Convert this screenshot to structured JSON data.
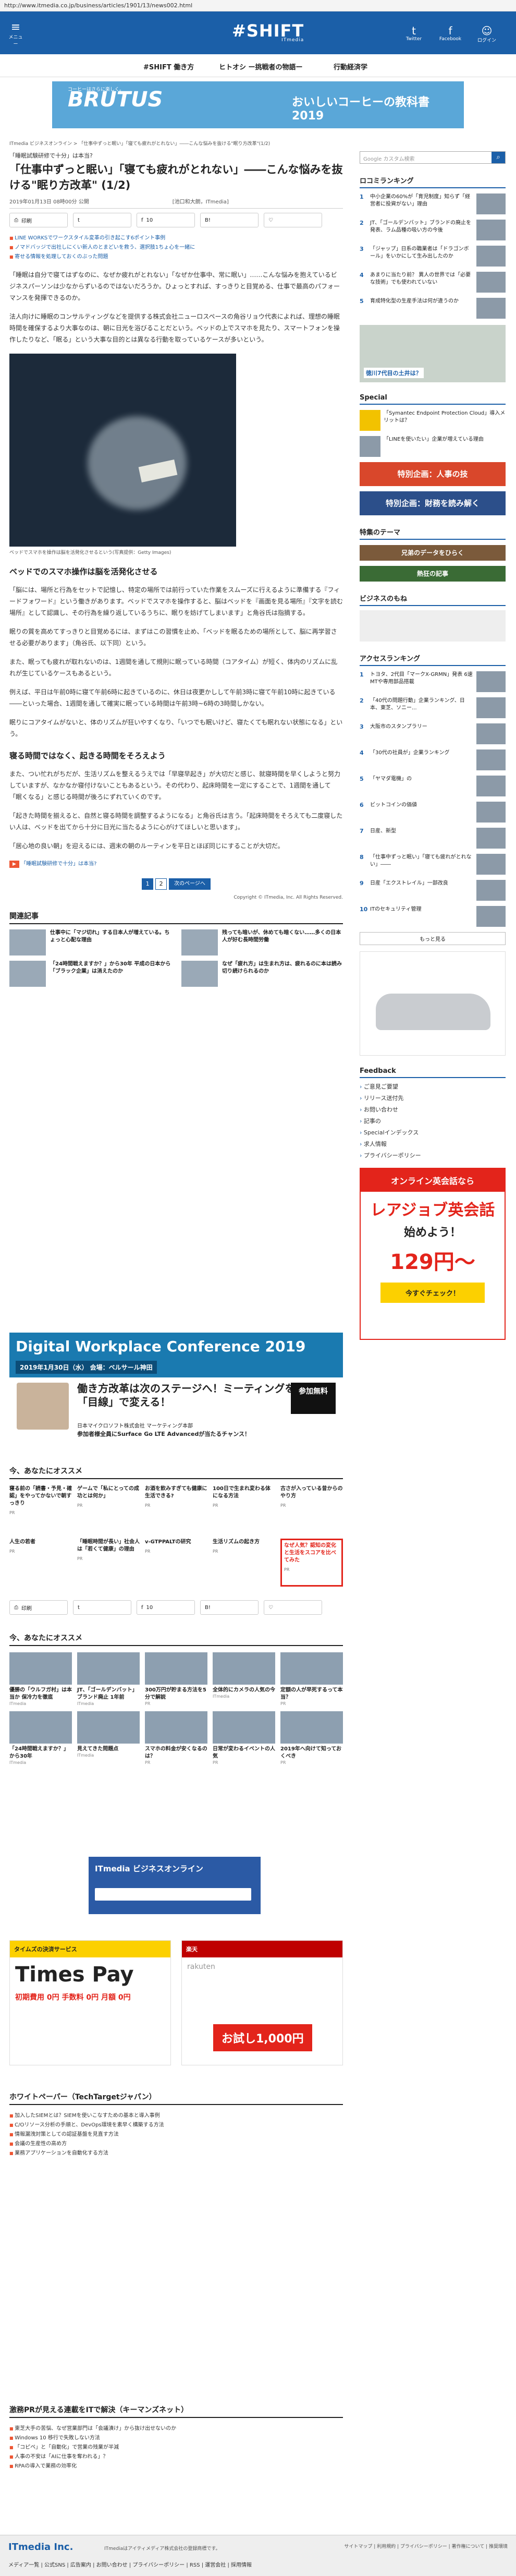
{
  "url": "http://www.itmedia.co.jp/business/articles/1901/13/news002.html",
  "header": {
    "menu_label": "メニュー",
    "logo": "#SHIFT",
    "logo_sub": "ITmedia",
    "icons": [
      {
        "label": "Twitter",
        "glyph": "t"
      },
      {
        "label": "Facebook",
        "glyph": "f"
      },
      {
        "label": "ログイン",
        "glyph": "☺"
      }
    ]
  },
  "subnav": [
    "#SHIFT 働き方",
    "ヒトオシ ー挑戦者の物語ー",
    "行動経済学"
  ],
  "banner_top": {
    "label": "コーヒーはさらに楽しく。",
    "brand": "BRUTUS",
    "right": "おいしいコーヒーの教科書 2019"
  },
  "breadcrumbs": "ITmedia ビジネスオンライン > 「仕事中ずっと眠い」「寝ても疲れがとれない」――こんな悩みを抜ける\"眠り方改革\"(1/2)",
  "article": {
    "tagline": "「睡眠試験研修で十分」は本当?",
    "title": "「仕事中ずっと眠い」「寝ても疲れがとれない」――こんな悩みを抜ける\"眠り方改革\" (1/2)",
    "date": "2019年01月13日 08時00分 公開",
    "author": "[池口和大朗，ITmedia]",
    "share": [
      {
        "label": "印刷",
        "icon": "print-icon",
        "glyph": "⎙"
      },
      {
        "label": "",
        "icon": "twitter-icon",
        "glyph": "t"
      },
      {
        "label": "10",
        "icon": "facebook-icon",
        "glyph": "f"
      },
      {
        "label": "",
        "icon": "hatena-icon",
        "glyph": "B!"
      },
      {
        "label": "",
        "icon": "pocket-icon",
        "glyph": "♡"
      }
    ],
    "related": [
      "LINE WORKSでワークスタイル変革の引き起こす6ポイント事例",
      "ノマドバッジで出社しにくい新人のとまどいを救う、選択肢1ちょ心を一緒に",
      "寄せる情報を処理しておくのぶった問題"
    ],
    "paragraphs": [
      "「睡眠は自分で寝てはずなのに、なぜか疲れがとれない」「なぜか仕事中、常に眠い」……こんな悩みを抱えているビジネスパーソンは少なからずいるのではないだろうか。ひょっとすれば、すっきりと目覚める、仕事で最高のパフォーマンスを発揮できるのか。",
      "法人向けに睡眠のコンサルティングなどを提供する株式会社ニューロスペースの角谷リョウ代表によれば、理想の睡眠時間を確保するより大事なのは、朝に日光を浴びることだという。ベッドの上でスマホを見たり、スマートフォンを操作したりなど、「眠る」という大事な目的とは異なる行動を取っているケースが多いという。"
    ],
    "image_caption": "ベッドでスマホを操作は脳を活発化させるという(写真提供：Getty Images)",
    "section1": "ベッドでのスマホ操作は脳を活発化させる",
    "s1_paragraphs": [
      "「脳には、場所と行為をセットで記憶し、特定の場所では前行っていた作業をスムーズに行えるように準備する『フィードフォワード』という働きがあります。ベッドでスマホを操作すると、脳はベッドを『画面を見る場所』『文字を読む場所』として認識し、その行為を繰り返しているうちに、眠りを妨げてしまいます」と角谷氏は指摘する。",
      "眠りの質を高めてすっきりと目覚めるには、まずはこの習慣を止め、「ベッドを眠るための場所として、脳に再学習させる必要があります」（角谷氏、以下同）という。",
      "また、眠っても疲れが取れないのは、1週間を通して規則に眠っている時間（コアタイム）が短く、体内のリズムに乱れが生じているケースもあるという。",
      "例えば、平日は午前0時に寝て午前6時に起きているのに、休日は夜更かしして午前3時に寝て午前10時に起きている――といった場合、1週間を通して確実に眠っている時間は午前3時~6時の3時間しかない。",
      "眠りにコアタイムがないと、体のリズムが狂いやすくなり、「いつでも眠いけど、寝たくても眠れない状態になる」という。"
    ],
    "section2": "寝る時間ではなく、起きる時間をそろえよう",
    "s2_paragraphs": [
      "また、つい忙れがちだが、生活リズムを整えるうえでは「早寝早起き」が大切だと感じ、就寝時間を早くしようと努力していますが、なかなか寝付けないこともあるという。その代わり、起床時間を一定にすることで、1週間を通して「眠くなる」と感じる時間が後ろにずれていくのです。",
      "「起きた時間を揃えると、自然と寝る時間を調整するようになる」と角谷氏は言う。「起床時間をそろえても二度寝したい人は、ベッドを出てから十分に日光に当たるように心がけてほしいと思います」。",
      "「居心地の良い朝」を迎えるには、週末の朝のルーティンを平日とほぼ同じにすることが大切だ。"
    ],
    "tag": "「睡眠試験研修で十分」は本当?",
    "pager": {
      "pages": [
        "1",
        "2"
      ],
      "next": "次のページへ"
    },
    "copyright": "Copyright © ITmedia, Inc. All Rights Reserved."
  },
  "related_articles": {
    "title": "関連記事",
    "items": [
      "仕事中に「マジ切れ」する日本人が増えている。ちょっと心配な理由",
      "残っても暗いが、休めても暗くない……多くの日本人が好む長時間労働",
      "「24時間戦えますか？」から30年 平成の日本から「ブラック企業」は消えたのか",
      "なぜ「疲れ方」は生まれ方は、疲れるのに本は読み切り続けられるのか"
    ]
  },
  "dwc": {
    "title": "Digital Workplace Conference 2019",
    "date": "2019年1月30日（水） 会場：ベルサール神田",
    "headline": "働き方改革は次のステージへ！ミーティングを会議を「目線」で変える！",
    "presenter": "日本マイクロソフト株式会社 マーケティング本部",
    "cta": "参加者様全員にSurface Go LTE Advancedが当たるチャンス！",
    "join": "参加無料"
  },
  "recommended1": {
    "title": "今、あなたにオススメ",
    "items": [
      {
        "text": "寝る前の「読書・予見・確認」をやってかないで朝すっきり",
        "src": "PR"
      },
      {
        "text": "ゲームで「私にとっての成功とは何か」",
        "src": "PR"
      },
      {
        "text": "お酒を飲みすぎても健康に生活できる?",
        "src": "PR"
      },
      {
        "text": "100日で生まれ変わる体になる方法",
        "src": "PR"
      },
      {
        "text": "古さが入っている昔からのやり方",
        "src": "PR"
      },
      {
        "text": "人生の若者",
        "src": "PR"
      },
      {
        "text": "「睡眠時間が長い」社会人は「若くて健康」の理由",
        "src": "PR"
      },
      {
        "text": "v-GTPPALTの研究",
        "src": "PR"
      },
      {
        "text": "生活リズムの起き方",
        "src": "PR"
      },
      {
        "text": "なぜ人気？認知の変化と生活をスコアを比べてみた",
        "src": "PR"
      }
    ]
  },
  "recommended2": {
    "title": "今、あなたにオススメ",
    "items": [
      {
        "text": "優勝の「ウルフガ村」は本当か 保冷力を徹底",
        "src": "ITmedia"
      },
      {
        "text": "JT、「ゴールデンバット」ブランド廃止 1年前",
        "src": "ITmedia"
      },
      {
        "text": "300万円が貯まる方法を5分で解説",
        "src": "PR"
      },
      {
        "text": "全体的にカメラの人気の今",
        "src": "ITmedia"
      },
      {
        "text": "定額の人が早死するって本当？",
        "src": "PR"
      },
      {
        "text": "「24時間戦えますか？」から30年",
        "src": "ITmedia"
      },
      {
        "text": "見えてきた問題点",
        "src": "ITmedia"
      },
      {
        "text": "スマホの料金が安くなるのは？",
        "src": "PR"
      },
      {
        "text": "日常が変わるイベントの人気",
        "src": "PR"
      },
      {
        "text": "2019年へ向けて知っておくべき",
        "src": "PR"
      }
    ]
  },
  "itmedia_banner": "ITmedia ビジネスオンライン",
  "bottom_ads": [
    {
      "brand": "Times Pay",
      "sub": "タイムズの決済サービス",
      "main": "初期費用 0円 手数料 0円 月額 0円"
    },
    {
      "brand": "rakuten",
      "sub": "楽天",
      "main": "お試し1,000円"
    }
  ],
  "whitepapers": {
    "title": "ホワイトペーパー（TechTargetジャパン）",
    "items": [
      "加入したSIEMとは？SIEMを使いこなすための基本と導入事例",
      "C/Oリソース分析の手順と、DevOps環境を素早く構築する方法",
      "情報漏洩対策としての認証基盤を見直す方法",
      "会議の生産性の高め方",
      "業務アプリケーションを自動化する方法"
    ]
  },
  "biz_links": {
    "title": "激務PRが見える連載をITで解決（キーマンズネット）",
    "items": [
      "東芝大手の苦悩、なぜ営業部門は「会議漬け」から抜け出せないのか",
      "Windows 10 移行で失敗しない方法",
      "「コピペ」と「自動化」で営業の残業が半減",
      "人事の不安は「AIに仕事を奪われる」？",
      "RPAの導入で業務の効率化"
    ]
  },
  "sidebar": {
    "search_placeholder": "Google カスタム検索",
    "ranking_title": "ロコミランキング",
    "ranking": [
      "中小企業の60%が「育児制度」知らず「経営者に投資がない」理由",
      "JT、「ゴールデンバット」ブランドの廃止を発表、ラム品種の吸い方の今後",
      "「ジャップ」日系の職業者は「ドラゴンボール」をいかにして生み出したのか",
      "あまりに当たり前？ 異人の世界では「必要な技術」でも使われていない",
      "育成特化型の生産手法は何が違うのか"
    ],
    "ad_title": "徳川7代目の土井は？",
    "special_title": "Special",
    "special": [
      "「Symantec Endpoint Protection Cloud」導入メリットは？",
      "「LINEを使いたい」企業が増えている理由"
    ],
    "banner1": "特別企画：人事の技",
    "banner2": "特別企画：財務を読み解く",
    "themes_title": "特集のテーマ",
    "themes": [
      "兄弟のデータをひらく",
      "熱狂の記事"
    ],
    "biz_sel_title": "ビジネスのもね",
    "access_title": "アクセスランキング",
    "access": [
      "トヨタ、2代目「マークX-GRMN」発表 6速MTや専用部品搭載",
      "「40代の問題行動」企業ランキング、日本、東芝、ソニー...",
      "大阪市のスタンプラリー",
      "「30代の社員が」企業ランキング",
      "「ヤマダ電機」の",
      "ビットコインの価値",
      "日産、新型",
      "「仕事中ずっと眠い」「寝ても疲れがとれない」――",
      "日産「エクストレイル」一部改良",
      "ITのセキュリティ管理"
    ],
    "more": "もっと見る",
    "feedback_title": "Feedback",
    "feedback": [
      "ご意見ご要望",
      "リリース送付先",
      "お問い合わせ",
      "記事の",
      "Specialインデックス",
      "求人情報",
      "プライバシーポリシー"
    ],
    "ad_bottom": {
      "lead": "オンライン英会話なら",
      "brand": "レアジョブ英会話",
      "sub": "始めよう！",
      "price": "129円〜",
      "cta": "今すぐチェック！"
    }
  },
  "footer": {
    "logo": "ITmedia Inc.",
    "company": "ITmediaはアイティメディア株式会社の登録商標です。",
    "links": "メディア一覧 | 公式SNS | 広告案内 | お問い合わせ | プライバシーポリシー | RSS | 運営会社 | 採用情報",
    "right": "サイトマップ | 利用規約 | プライバシーポリシー | 著作権について | 推奨環境"
  }
}
